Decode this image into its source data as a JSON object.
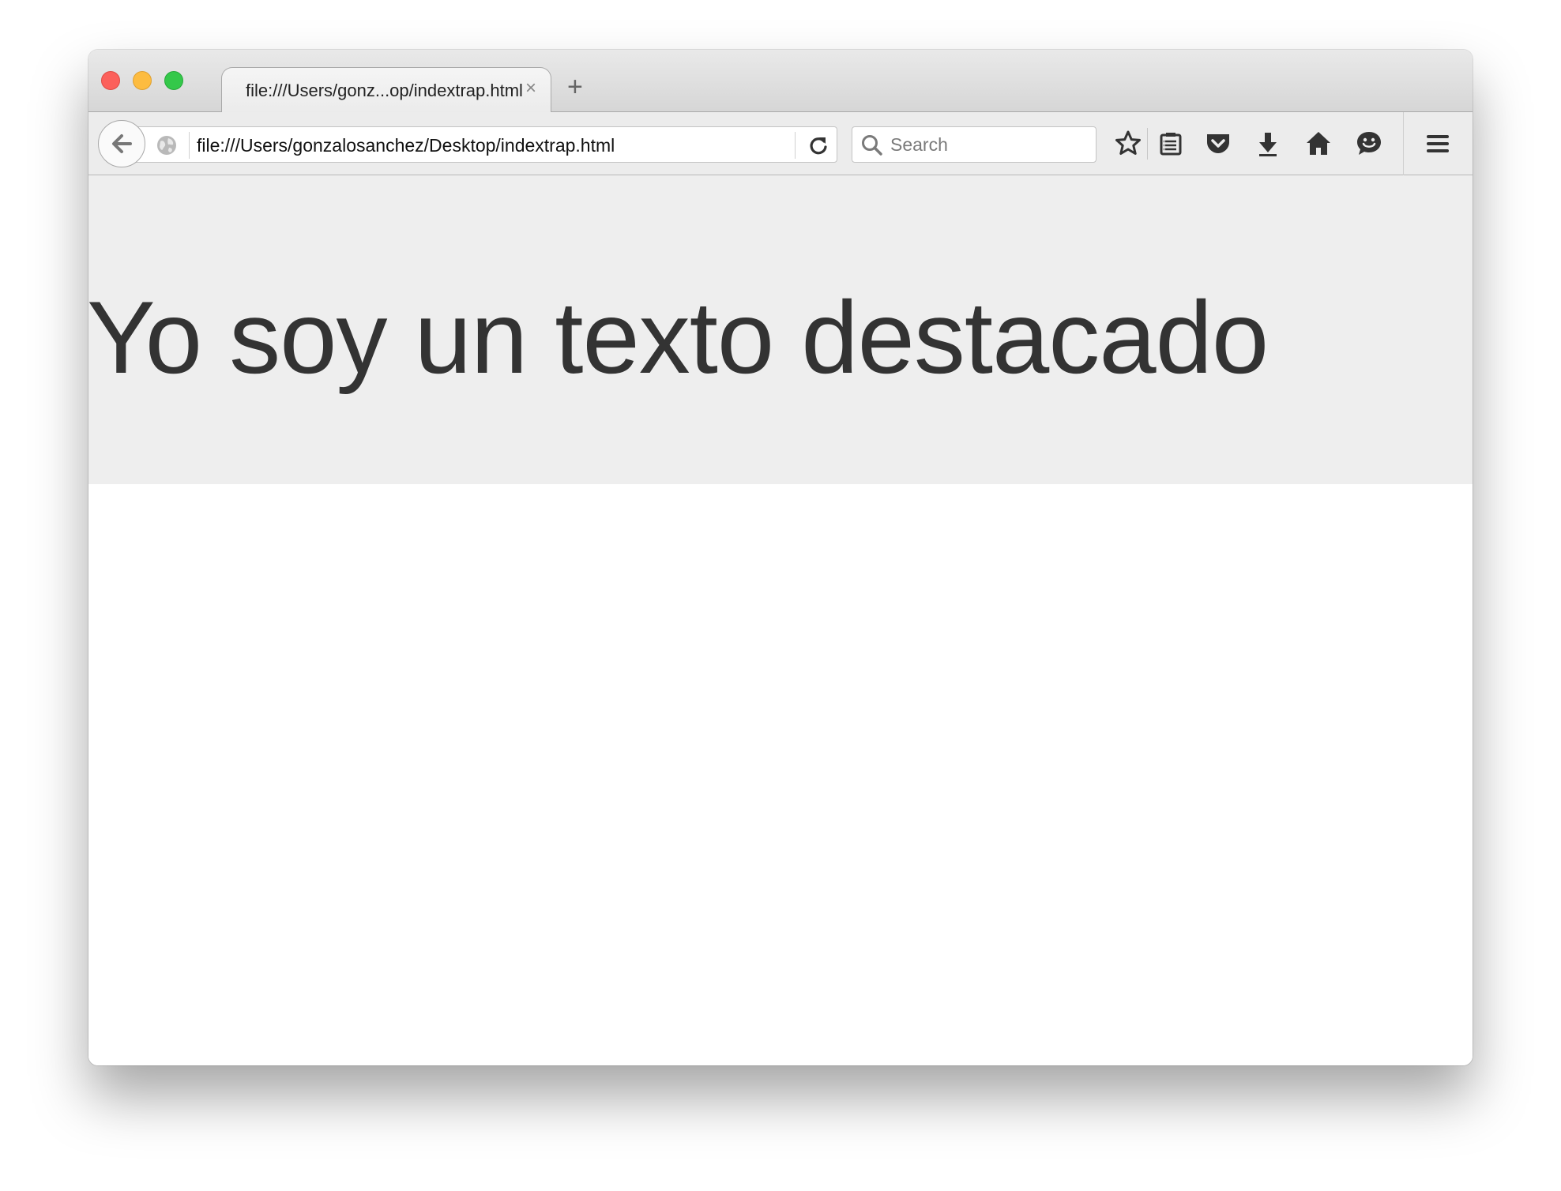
{
  "tab": {
    "title": "file:///Users/gonz...op/indextrap.html",
    "close_glyph": "×",
    "new_tab_glyph": "+"
  },
  "navbar": {
    "url": "file:///Users/gonzalosanchez/Desktop/indextrap.html",
    "search_placeholder": "Search",
    "icons": [
      "back-arrow-icon",
      "globe-icon",
      "reload-icon",
      "search-icon",
      "bookmark-star-icon",
      "reading-list-icon",
      "pocket-icon",
      "download-icon",
      "home-icon",
      "hello-chat-icon",
      "hamburger-menu-icon"
    ]
  },
  "page": {
    "headline": "Yo soy un texto destacado"
  },
  "colors": {
    "jumbotron_bg": "#eeeeee",
    "headline_text": "#333333",
    "close_button": "#fc605b",
    "minimize_button": "#fdbc40",
    "maximize_button": "#34c84a"
  }
}
